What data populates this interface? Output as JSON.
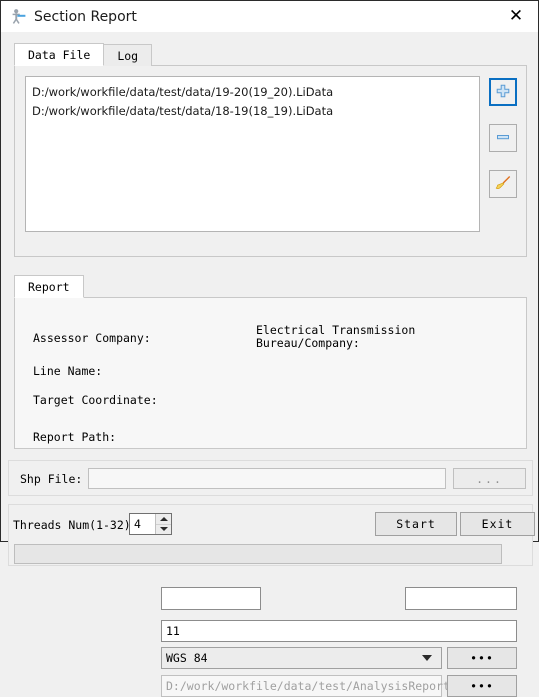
{
  "window": {
    "title": "Section Report",
    "icon": "app-person-icon",
    "close_label": "✕"
  },
  "top_tabs": {
    "items": [
      {
        "label": "Data File",
        "active": true
      },
      {
        "label": "Log",
        "active": false
      }
    ]
  },
  "data_file": {
    "files": [
      "D:/work/workfile/data/test/data/19-20(19_20).LiData",
      "D:/work/workfile/data/test/data/18-19(18_19).LiData"
    ],
    "buttons": [
      {
        "name": "add-file-button",
        "icon": "plus-icon",
        "focused": true
      },
      {
        "name": "remove-file-button",
        "icon": "minus-icon",
        "focused": false
      },
      {
        "name": "clear-files-button",
        "icon": "brush-icon",
        "focused": false
      }
    ]
  },
  "report_tabs": {
    "items": [
      {
        "label": "Report",
        "active": true
      }
    ]
  },
  "report_form": {
    "assessor_company_label": "Assessor Company:",
    "assessor_company_value": "",
    "electrical_bureau_label_line1": "Electrical Transmission",
    "electrical_bureau_label_line2": "Bureau/Company:",
    "electrical_bureau_value": "",
    "line_name_label": "Line Name:",
    "line_name_value": "11",
    "target_coordinate_label": "Target Coordinate:",
    "target_coordinate_value": "WGS 84",
    "target_coordinate_browse": "•••",
    "report_path_label": "Report Path:",
    "report_path_value": "D:/work/workfile/data/test/AnalysisReport/",
    "report_path_browse": "•••"
  },
  "shp": {
    "label": "Shp File:",
    "value": "",
    "browse_label": "..."
  },
  "bottom": {
    "threads_label": "Threads Num(1-32):",
    "threads_value": "4",
    "start_label": "Start",
    "exit_label": "Exit",
    "progress_value": ""
  },
  "colors": {
    "focus_blue": "#0a6fc2",
    "window_bg": "#f0f0f0",
    "panel_bg": "#f7f7f7",
    "titlebar_bg": "#ffffff"
  }
}
